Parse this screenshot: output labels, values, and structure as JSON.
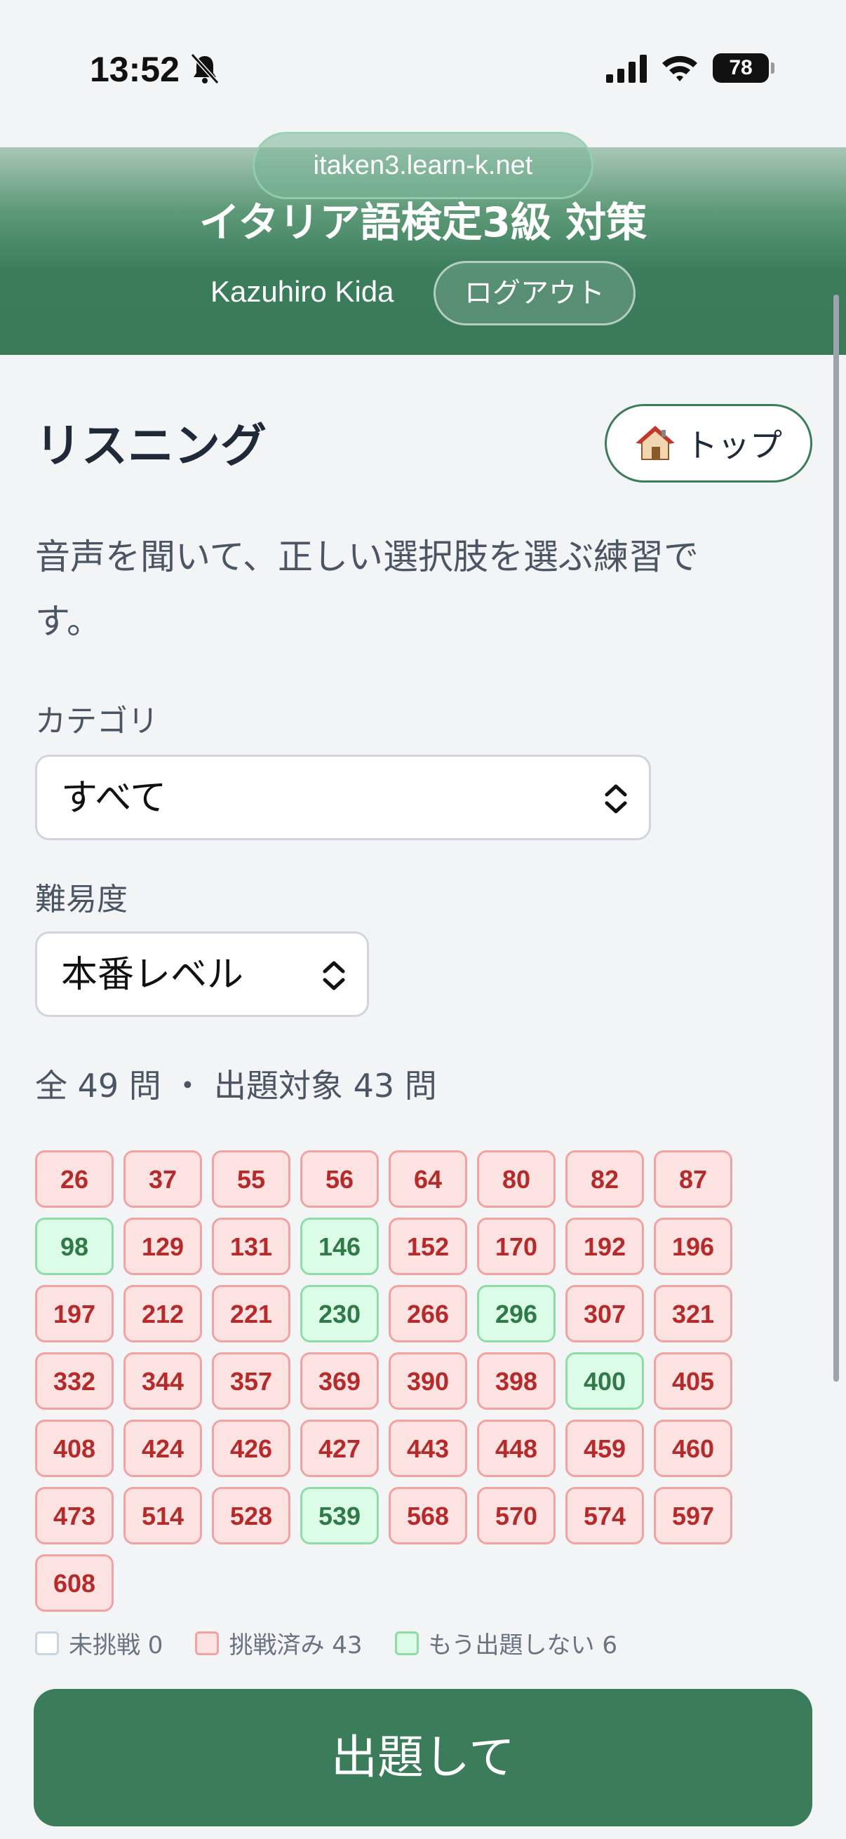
{
  "status_bar": {
    "time": "13:52",
    "battery": "78"
  },
  "header": {
    "url": "itaken3.learn-k.net",
    "title": "イタリア語検定3級 対策",
    "user_name": "Kazuhiro Kida",
    "logout_label": "ログアウト"
  },
  "main": {
    "title": "リスニング",
    "top_button_label": "トップ",
    "description": "音声を聞いて、正しい選択肢を選ぶ練習です。",
    "category_label": "カテゴリ",
    "category_value": "すべて",
    "difficulty_label": "難易度",
    "difficulty_value": "本番レベル",
    "count_text": "全 49 問 ・ 出題対象 43 問"
  },
  "questions": [
    {
      "n": "26",
      "s": "done"
    },
    {
      "n": "37",
      "s": "done"
    },
    {
      "n": "55",
      "s": "done"
    },
    {
      "n": "56",
      "s": "done"
    },
    {
      "n": "64",
      "s": "done"
    },
    {
      "n": "80",
      "s": "done"
    },
    {
      "n": "82",
      "s": "done"
    },
    {
      "n": "87",
      "s": "done"
    },
    {
      "n": "98",
      "s": "skip"
    },
    {
      "n": "129",
      "s": "done"
    },
    {
      "n": "131",
      "s": "done"
    },
    {
      "n": "146",
      "s": "skip"
    },
    {
      "n": "152",
      "s": "done"
    },
    {
      "n": "170",
      "s": "done"
    },
    {
      "n": "192",
      "s": "done"
    },
    {
      "n": "196",
      "s": "done"
    },
    {
      "n": "197",
      "s": "done"
    },
    {
      "n": "212",
      "s": "done"
    },
    {
      "n": "221",
      "s": "done"
    },
    {
      "n": "230",
      "s": "skip"
    },
    {
      "n": "266",
      "s": "done"
    },
    {
      "n": "296",
      "s": "skip"
    },
    {
      "n": "307",
      "s": "done"
    },
    {
      "n": "321",
      "s": "done"
    },
    {
      "n": "332",
      "s": "done"
    },
    {
      "n": "344",
      "s": "done"
    },
    {
      "n": "357",
      "s": "done"
    },
    {
      "n": "369",
      "s": "done"
    },
    {
      "n": "390",
      "s": "done"
    },
    {
      "n": "398",
      "s": "done"
    },
    {
      "n": "400",
      "s": "skip"
    },
    {
      "n": "405",
      "s": "done"
    },
    {
      "n": "408",
      "s": "done"
    },
    {
      "n": "424",
      "s": "done"
    },
    {
      "n": "426",
      "s": "done"
    },
    {
      "n": "427",
      "s": "done"
    },
    {
      "n": "443",
      "s": "done"
    },
    {
      "n": "448",
      "s": "done"
    },
    {
      "n": "459",
      "s": "done"
    },
    {
      "n": "460",
      "s": "done"
    },
    {
      "n": "473",
      "s": "done"
    },
    {
      "n": "514",
      "s": "done"
    },
    {
      "n": "528",
      "s": "done"
    },
    {
      "n": "539",
      "s": "skip"
    },
    {
      "n": "568",
      "s": "done"
    },
    {
      "n": "570",
      "s": "done"
    },
    {
      "n": "574",
      "s": "done"
    },
    {
      "n": "597",
      "s": "done"
    },
    {
      "n": "608",
      "s": "done"
    }
  ],
  "legend": {
    "untried": "未挑戦 0",
    "tried": "挑戦済み 43",
    "skip": "もう出題しない 6"
  },
  "start_button_label": "出題して",
  "colors": {
    "brand_green": "#3b7d5b",
    "tried_bg": "#fde2e2",
    "tried_text": "#b52a2a",
    "skip_bg": "#dcfce7",
    "skip_text": "#2f7a48"
  }
}
